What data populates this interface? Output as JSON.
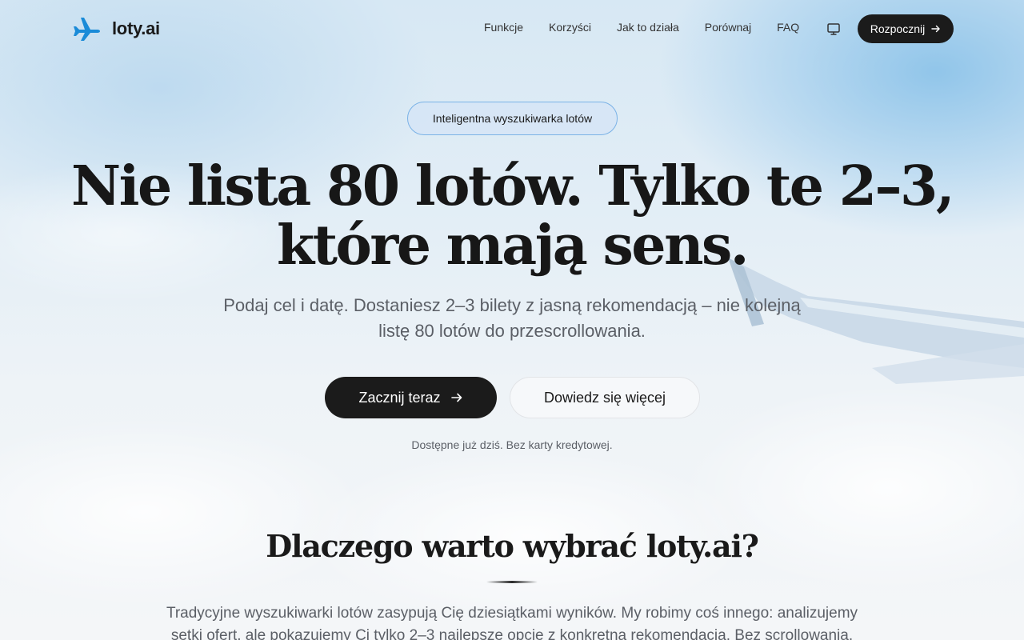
{
  "header": {
    "logo_text": "loty.ai",
    "nav": [
      {
        "label": "Funkcje"
      },
      {
        "label": "Korzyści"
      },
      {
        "label": "Jak to działa"
      },
      {
        "label": "Porównaj"
      },
      {
        "label": "FAQ"
      }
    ],
    "cta_label": "Rozpocznij"
  },
  "hero": {
    "badge": "Inteligentna wyszukiwarka lotów",
    "title_line1": "Nie lista 80 lotów. Tylko te 2–3,",
    "title_line2": "które mają sens.",
    "subtitle_line1": "Podaj cel i datę. Dostaniesz 2–3 bilety z jasną rekomendacją – nie kolejną",
    "subtitle_line2": "listę 80 lotów do przescrollowania.",
    "primary_button": "Zacznij teraz",
    "secondary_button": "Dowiedz się więcej",
    "note": "Dostępne już dziś. Bez karty kredytowej."
  },
  "why": {
    "title": "Dlaczego warto wybrać loty.ai?",
    "text_line1": "Tradycyjne wyszukiwarki lotów zasypują Cię dziesiątkami wyników. My robimy coś innego: analizujemy",
    "text_line2": "setki ofert, ale pokazujemy Ci tylko 2–3 najlepsze opcje z konkretną rekomendacją. Bez scrollowania."
  },
  "icons": {
    "logo": "airplane-icon",
    "theme": "monitor-icon",
    "arrow": "arrow-right-icon"
  },
  "colors": {
    "accent": "#1a8bd8",
    "dark_button": "#1b1b1b",
    "badge_border": "#7ab2e6"
  }
}
